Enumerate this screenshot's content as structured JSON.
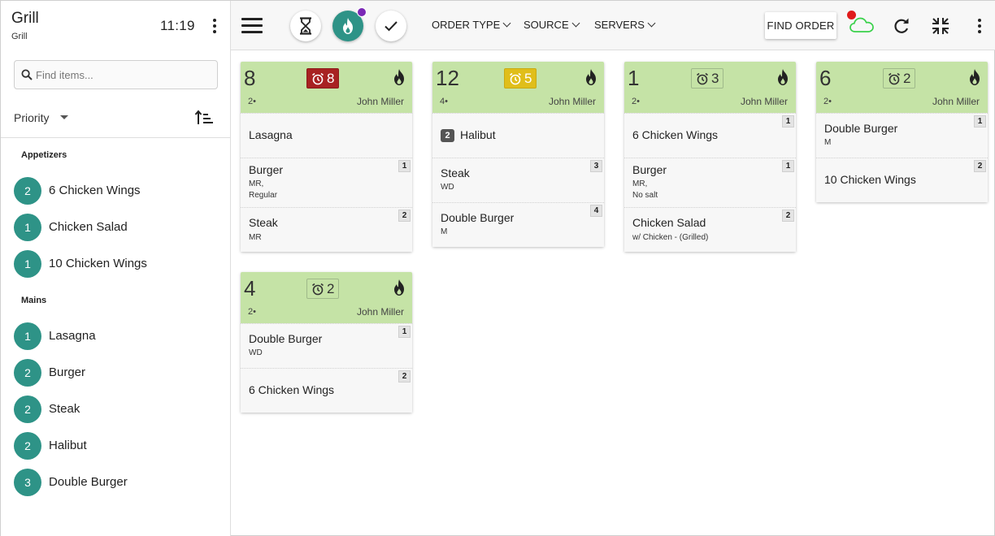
{
  "sidebar": {
    "title": "Grill",
    "subtitle": "Grill",
    "clock": "11:19",
    "search_placeholder": "Find items...",
    "sort_label": "Priority",
    "sections": [
      {
        "label": "Appetizers",
        "items": [
          {
            "count": "2",
            "name": "6 Chicken Wings"
          },
          {
            "count": "1",
            "name": "Chicken Salad"
          },
          {
            "count": "1",
            "name": "10 Chicken Wings"
          }
        ]
      },
      {
        "label": "Mains",
        "items": [
          {
            "count": "1",
            "name": "Lasagna"
          },
          {
            "count": "2",
            "name": "Burger"
          },
          {
            "count": "2",
            "name": "Steak"
          },
          {
            "count": "2",
            "name": "Halibut"
          },
          {
            "count": "3",
            "name": "Double Burger"
          }
        ]
      }
    ]
  },
  "topbar": {
    "filters": [
      "ORDER TYPE",
      "SOURCE",
      "SERVERS"
    ],
    "find_order_label": "FIND ORDER",
    "icons": [
      "menu-icon",
      "hourglass-icon",
      "fire-icon",
      "check-icon",
      "cloud-icon",
      "refresh-icon",
      "collapse-icon",
      "more-vert-icon"
    ],
    "colors": {
      "accent": "#2e9387",
      "notification": "#7a27b5",
      "offline": "#e01b1b",
      "cloud": "#39d14a"
    }
  },
  "orders": [
    {
      "number": "8",
      "timer": "8",
      "timer_style": "red",
      "guests": "2",
      "server": "John Miller",
      "lines": [
        {
          "name": "Lasagna",
          "qty": "",
          "mods": []
        },
        {
          "name": "Burger",
          "qty": "1",
          "mods": [
            "MR,",
            "Regular"
          ]
        },
        {
          "name": "Steak",
          "qty": "2",
          "mods": [
            "MR"
          ]
        }
      ]
    },
    {
      "number": "12",
      "timer": "5",
      "timer_style": "yellow",
      "guests": "4",
      "server": "John Miller",
      "lines": [
        {
          "name": "Halibut",
          "qty_inline": "2",
          "mods": []
        },
        {
          "name": "Steak",
          "qty": "3",
          "mods": [
            "WD"
          ]
        },
        {
          "name": "Double Burger",
          "qty": "4",
          "mods": [
            "M"
          ]
        }
      ]
    },
    {
      "number": "1",
      "timer": "3",
      "timer_style": "plain",
      "guests": "2",
      "server": "John Miller",
      "lines": [
        {
          "name": "6 Chicken Wings",
          "qty": "1",
          "mods": []
        },
        {
          "name": "Burger",
          "qty": "1",
          "mods": [
            "MR,",
            "No salt"
          ]
        },
        {
          "name": "Chicken Salad",
          "qty": "2",
          "mods": [
            "w/ Chicken - (Grilled)"
          ]
        }
      ]
    },
    {
      "number": "6",
      "timer": "2",
      "timer_style": "plain",
      "guests": "2",
      "server": "John Miller",
      "lines": [
        {
          "name": "Double Burger",
          "qty": "1",
          "mods": [
            "M"
          ]
        },
        {
          "name": "10 Chicken Wings",
          "qty": "2",
          "mods": []
        }
      ]
    },
    {
      "number": "4",
      "timer": "2",
      "timer_style": "plain",
      "guests": "2",
      "server": "John Miller",
      "lines": [
        {
          "name": "Double Burger",
          "qty": "1",
          "mods": [
            "WD"
          ]
        },
        {
          "name": "6 Chicken Wings",
          "qty": "2",
          "mods": []
        }
      ]
    }
  ]
}
